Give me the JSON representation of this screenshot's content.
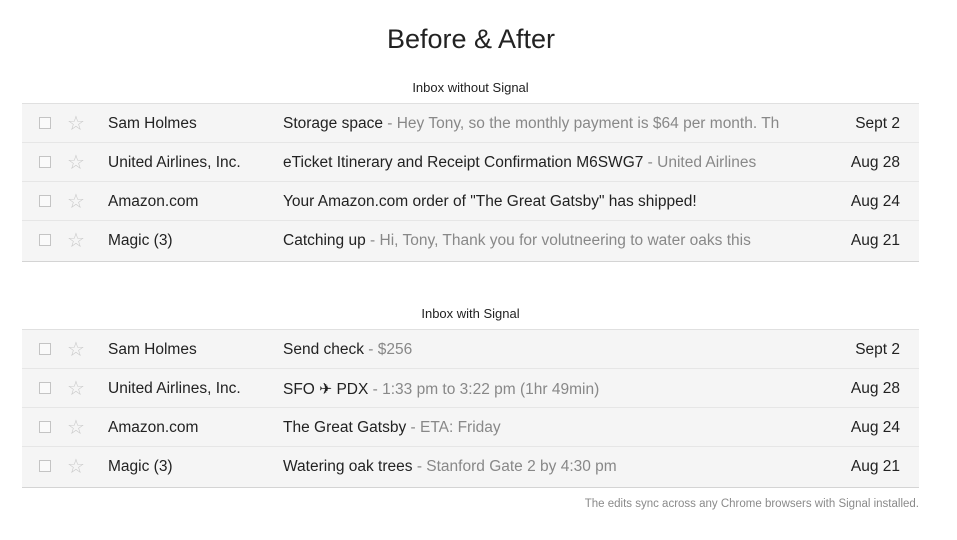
{
  "title": "Before & After",
  "inbox_without": {
    "label": "Inbox without Signal",
    "rows": [
      {
        "sender": "Sam Holmes",
        "subject": "Storage space",
        "snippet": " - Hey Tony, so the monthly payment is $64 per month. Th",
        "date": "Sept 2"
      },
      {
        "sender": "United Airlines, Inc.",
        "subject": "eTicket Itinerary and Receipt Confirmation M6SWG7",
        "snippet": " - United Airlines",
        "date": "Aug 28"
      },
      {
        "sender": "Amazon.com",
        "subject": "Your Amazon.com order of \"The Great Gatsby\" has shipped!",
        "snippet": "",
        "date": "Aug 24"
      },
      {
        "sender": "Magic (3)",
        "subject": "Catching up",
        "snippet": " - Hi, Tony, Thank you for volutneering to water oaks this",
        "date": "Aug 21"
      }
    ]
  },
  "inbox_with": {
    "label": "Inbox with Signal",
    "rows": [
      {
        "sender": "Sam Holmes",
        "subject": "Send check",
        "snippet": " - $256",
        "date": "Sept 2"
      },
      {
        "sender": "United Airlines, Inc.",
        "subject": "SFO ✈ PDX",
        "snippet": " - 1:33 pm to 3:22 pm (1hr 49min)",
        "date": "Aug 28"
      },
      {
        "sender": "Amazon.com",
        "subject": "The Great Gatsby",
        "snippet": " - ETA: Friday",
        "date": "Aug 24"
      },
      {
        "sender": "Magic (3)",
        "subject": "Watering oak trees",
        "snippet": " - Stanford Gate 2 by 4:30 pm",
        "date": "Aug 21"
      }
    ]
  },
  "footnote": "The edits sync across any Chrome browsers with Signal installed.",
  "icons": {
    "checkbox": "checkbox-icon",
    "star": "star-icon"
  },
  "colors": {
    "row_bg": "#f5f5f5",
    "snippet": "#888888",
    "star": "#c9c9c9",
    "border": "#e0e0e0"
  }
}
